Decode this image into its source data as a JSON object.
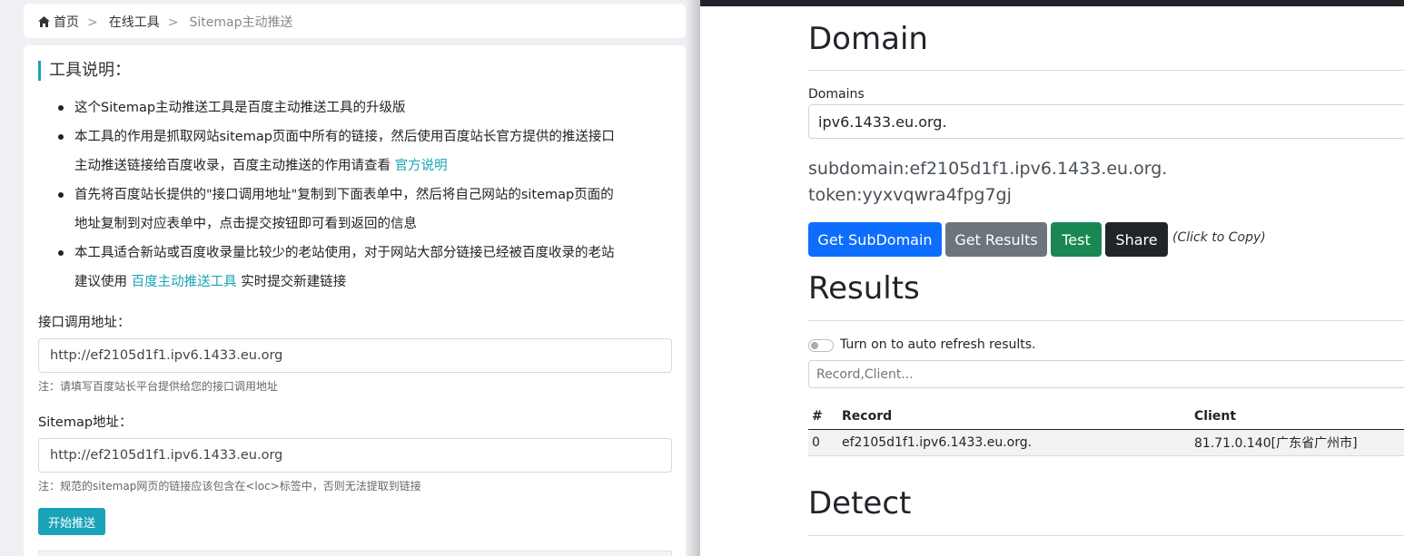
{
  "breadcrumb": {
    "home": "首页",
    "separator": ">",
    "tools": "在线工具",
    "current": "Sitemap主动推送"
  },
  "tool_info": {
    "title": "工具说明：",
    "items": [
      {
        "text": "这个Sitemap主动推送工具是百度主动推送工具的升级版"
      },
      {
        "text": "本工具的作用是抓取网站sitemap页面中所有的链接，然后使用百度站长官方提供的推送接口",
        "text2": "主动推送链接给百度收录，百度主动推送的作用请查看",
        "link": "官方说明"
      },
      {
        "text": "首先将百度站长提供的\"接口调用地址\"复制到下面表单中，然后将自己网站的sitemap页面的",
        "text2": "地址复制到对应表单中，点击提交按钮即可看到返回的信息"
      },
      {
        "text": "本工具适合新站或百度收录量比较少的老站使用，对于网站大部分链接已经被百度收录的老站",
        "text2": "建议使用",
        "link": "百度主动推送工具",
        "text3": "实时提交新建链接"
      }
    ]
  },
  "form": {
    "api_label": "接口调用地址：",
    "api_value": "http://ef2105d1f1.ipv6.1433.eu.org",
    "api_note": "注：请填写百度站长平台提供给您的接口调用地址",
    "sitemap_label": "Sitemap地址：",
    "sitemap_value": "http://ef2105d1f1.ipv6.1433.eu.org",
    "sitemap_note": "注：规范的sitemap网页的链接应该包含在<loc>标签中，否则无法提取到链接",
    "submit_label": "开始推送"
  },
  "dnslog": {
    "domain_heading": "Domain",
    "domains_label": "Domains",
    "domains_value": "ipv6.1433.eu.org.",
    "subdomain_line": "subdomain:ef2105d1f1.ipv6.1433.eu.org.",
    "token_line": "token:yyxvqwra4fpg7gj",
    "buttons": {
      "get_subdomain": "Get SubDomain",
      "get_results": "Get Results",
      "test": "Test",
      "share": "Share",
      "copy_hint": "(Click to Copy)"
    },
    "results_heading": "Results",
    "auto_refresh_label": "Turn on to auto refresh results.",
    "filter_placeholder": "Record,Client...",
    "table": {
      "headers": [
        "#",
        "Record",
        "Client"
      ],
      "rows": [
        [
          "0",
          "ef2105d1f1.ipv6.1433.eu.org.",
          "81.71.0.140[广东省广州市]"
        ]
      ]
    },
    "detect_heading": "Detect"
  },
  "colors": {
    "accent_teal": "#1aa3b8",
    "btn_primary": "#0d6efd",
    "btn_secondary": "#6c757d",
    "btn_success": "#198754",
    "btn_dark": "#212529"
  }
}
